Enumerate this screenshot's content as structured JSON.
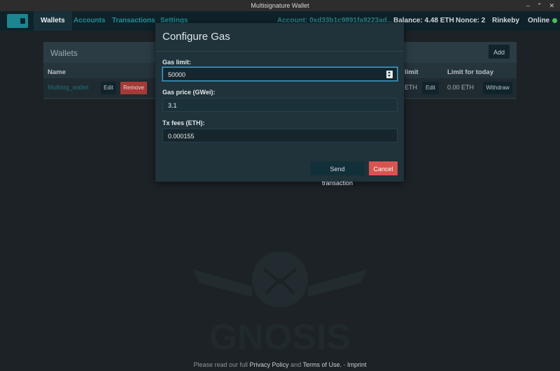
{
  "window": {
    "title": "Multisignature Wallet",
    "controls": [
      "–",
      "⌃",
      "✕"
    ]
  },
  "navbar": {
    "tabs": [
      {
        "label": "Wallets",
        "active": true
      },
      {
        "label": "Accounts",
        "active": false
      },
      {
        "label": "Transactions",
        "active": false
      },
      {
        "label": "Settings",
        "active": false
      }
    ],
    "account": "Account: 0xd33b1c9891fa9223ad...",
    "balance": "Balance: 4.48 ETH",
    "nonce": "Nonce: 2",
    "network": "Rinkeby",
    "status": "Online",
    "status_color": "#46c05b"
  },
  "wallets_panel": {
    "title": "Wallets",
    "add_label": "Add",
    "columns": [
      "Name",
      "limit",
      "Limit for today"
    ],
    "row": {
      "name": "Multisig_wallet",
      "edit_label": "Edit",
      "remove_label": "Remove",
      "eth": "ETH",
      "edit2_label": "Edit",
      "today": "0.00 ETH",
      "withdraw_label": "Withdraw"
    }
  },
  "modal": {
    "title": "Configure Gas",
    "gas_limit_label": "Gas limit:",
    "gas_limit_value": "50000",
    "gas_price_label": "Gas price (GWei):",
    "gas_price_value": "3.1",
    "tx_fees_label": "Tx fees (ETH):",
    "tx_fees_value": "0.000155",
    "send_label": "Send transaction",
    "cancel_label": "Cancel"
  },
  "footer": {
    "prefix": "Please read our full",
    "privacy": "Privacy Policy",
    "and": "and",
    "terms": "Terms of Use.",
    "dash": "-",
    "imprint": "Imprint"
  },
  "watermark": {
    "text": "GNOSIS"
  },
  "colors": {
    "accent": "#1e8e97",
    "cancel": "#d9534f",
    "remove": "#a63a37"
  }
}
